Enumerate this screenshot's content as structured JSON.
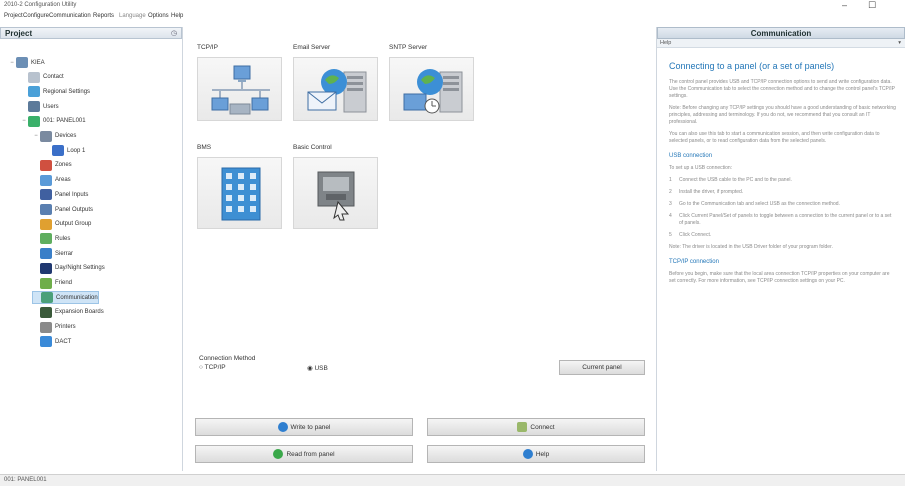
{
  "window": {
    "title": "2010-2 Configuration Utility",
    "controls": [
      "–",
      "☐"
    ]
  },
  "menu": [
    {
      "label": "Project",
      "enabled": true
    },
    {
      "label": "Configure",
      "enabled": true
    },
    {
      "label": "Communication",
      "enabled": true
    },
    {
      "label": "Reports",
      "enabled": true
    },
    {
      "label": "Language",
      "enabled": false
    },
    {
      "label": "Options",
      "enabled": true
    },
    {
      "label": "Help",
      "enabled": true
    }
  ],
  "project_panel": {
    "title": "Project",
    "pin": "◷",
    "tree": [
      {
        "label": "KIEA",
        "toggle": "−",
        "color": "#6c8fb5"
      },
      {
        "label": "Contact",
        "toggle": "",
        "color": "#b8c2ce"
      },
      {
        "label": "Regional Settings",
        "toggle": "",
        "color": "#4aa0d8"
      },
      {
        "label": "Users",
        "toggle": "",
        "color": "#5c7a9a"
      },
      {
        "label": "001: PANEL001",
        "toggle": "−",
        "color": "#3ab06a"
      },
      {
        "label": "Devices",
        "toggle": "−",
        "color": "#7a8aa0"
      },
      {
        "label": "Loop 1",
        "toggle": "",
        "color": "#3b6fc8"
      },
      {
        "label": "Zones",
        "toggle": "",
        "color": "#d05040"
      },
      {
        "label": "Areas",
        "toggle": "",
        "color": "#5a9ad8"
      },
      {
        "label": "Panel Inputs",
        "toggle": "",
        "color": "#4060a0"
      },
      {
        "label": "Panel Outputs",
        "toggle": "",
        "color": "#5a7fb0"
      },
      {
        "label": "Output Group",
        "toggle": "",
        "color": "#e0a030"
      },
      {
        "label": "Rules",
        "toggle": "",
        "color": "#5fae5f"
      },
      {
        "label": "Sierrar",
        "toggle": "",
        "color": "#3a7fc8"
      },
      {
        "label": "Day/Night Settings",
        "toggle": "",
        "color": "#203870"
      },
      {
        "label": "Friend",
        "toggle": "",
        "color": "#6fae4a"
      },
      {
        "label": "Communication",
        "toggle": "",
        "color": "#4aa07a",
        "selected": true
      },
      {
        "label": "Expansion Boards",
        "toggle": "",
        "color": "#3a5a3a"
      },
      {
        "label": "Printers",
        "toggle": "",
        "color": "#8a8a8a"
      },
      {
        "label": "DACT",
        "toggle": "",
        "color": "#3a8ad8"
      }
    ]
  },
  "center": {
    "tiles": [
      {
        "label": "TCP/IP",
        "icon": "network-icon"
      },
      {
        "label": "Email Server",
        "icon": "email-server-icon"
      },
      {
        "label": "SNTP Server",
        "icon": "sntp-server-icon"
      },
      {
        "label": "BMS",
        "icon": "building-icon"
      },
      {
        "label": "Basic Control",
        "icon": "basic-control-icon"
      }
    ],
    "connection_method": {
      "label": "Connection Method",
      "options": [
        "TCP/IP",
        "USB"
      ],
      "selected": "USB",
      "current_panel_button": "Current panel"
    },
    "actions": {
      "write": "Write to panel",
      "read": "Read from panel",
      "connect": "Connect",
      "help": "Help"
    }
  },
  "help_panel": {
    "header": "Communication",
    "tab": "Help",
    "pin": "▾",
    "title": "Connecting to a panel (or a set of panels)",
    "intro": [
      "The control panel provides USB and TCP/IP connection options to send and write configuration data. Use the Communication tab to select the connection method and to change the control panel's TCP/IP settings.",
      "Note: Before changing any TCP/IP settings you should have a good understanding of basic networking principles, addressing and terminology. If you do not, we recommend that you consult an IT professional.",
      "You can also use this tab to start a communication session, and then write configuration data to selected panels, or to read configuration data from the selected panels."
    ],
    "usb_section": {
      "title": "USB connection",
      "lead": "To set up a USB connection:",
      "steps": [
        "Connect the USB cable to the PC and to the panel.",
        "Install the driver, if prompted.",
        "Go to the Communication tab and select USB as the connection method.",
        "Click Current Panel/Set of panels to toggle between a connection to the current panel or to a set of panels.",
        "Click Connect."
      ],
      "note": "Note: The driver is located in the USB Driver folder of your program folder."
    },
    "tcpip_section": {
      "title": "TCP/IP connection",
      "text": "Before you begin, make sure that the local area connection TCP/IP properties on your computer are set correctly. For more information, see TCP/IP connection settings on your PC."
    }
  },
  "status": {
    "text": "001: PANEL001"
  }
}
